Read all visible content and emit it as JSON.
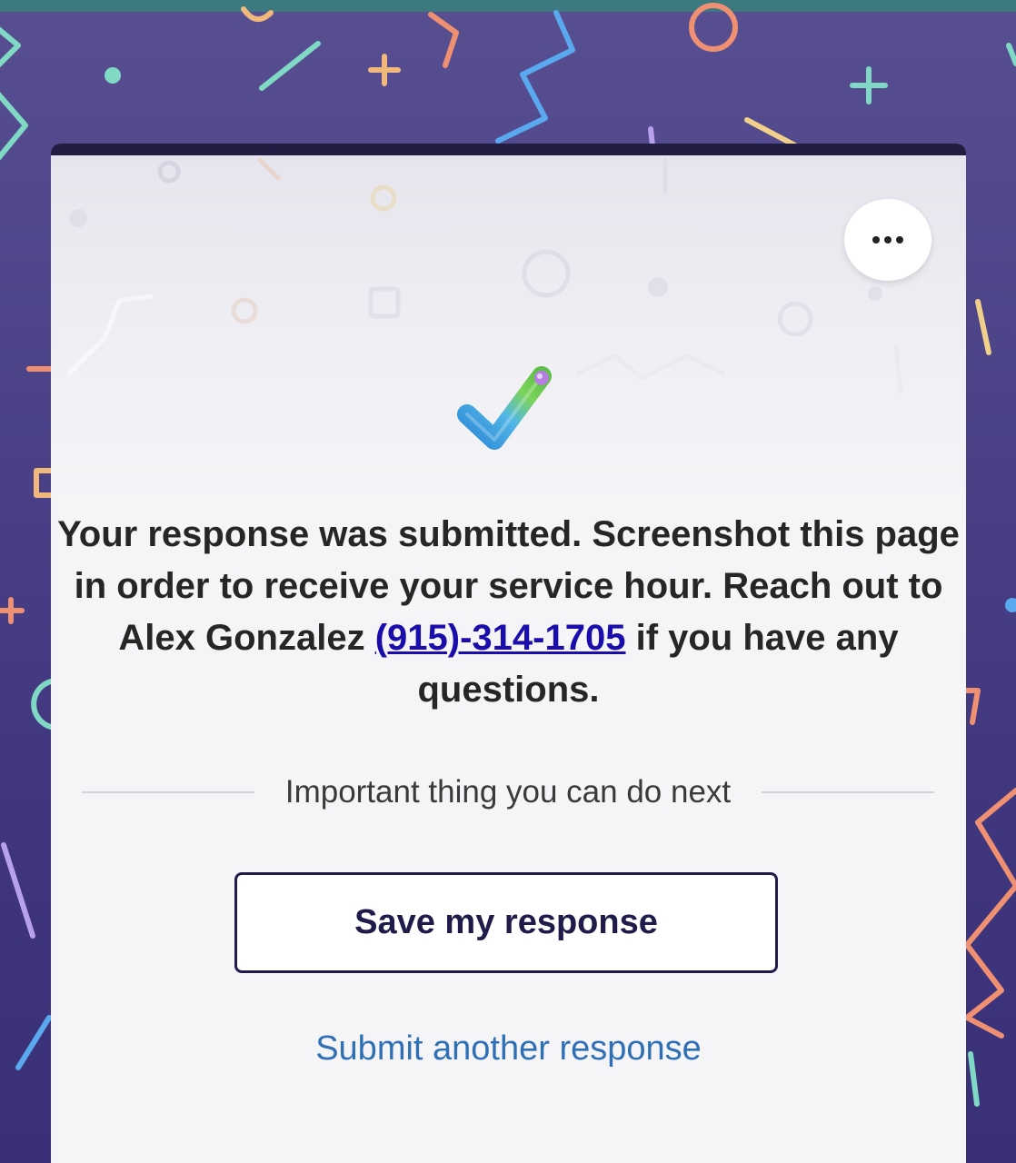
{
  "page": {
    "accent_color": "#4b4288",
    "card_color": "#f5f5f8"
  },
  "menu": {
    "icon": "more-horizontal-icon"
  },
  "confirmation": {
    "icon": "checkmark-icon",
    "message_part1": "Your response was submitted. Screenshot this page in order to receive your service hour. Reach out to Alex Gonzalez ",
    "phone_link": "(915)-314-1705",
    "message_part2": " if you have any questions."
  },
  "next_steps": {
    "heading": "Important thing you can do next",
    "save_button_label": "Save my response",
    "submit_another_label": "Submit another response"
  }
}
